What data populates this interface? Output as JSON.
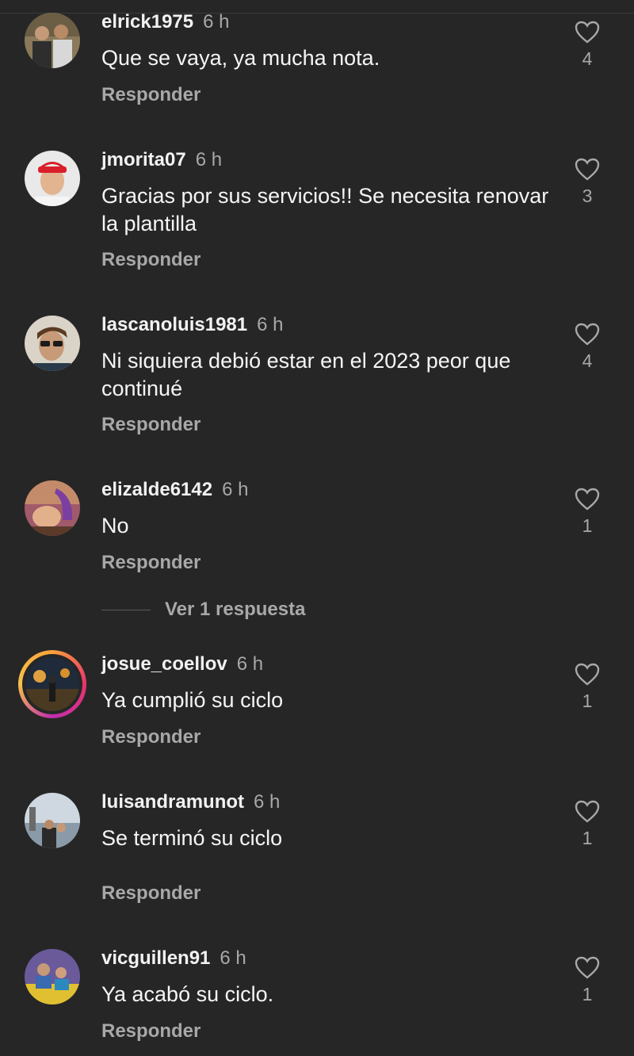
{
  "comments": [
    {
      "username": "elrick1975",
      "time": "6 h",
      "text": "Que se vaya, ya mucha nota.",
      "likes": "4",
      "reply": "Responder"
    },
    {
      "username": "jmorita07",
      "time": "6 h",
      "text": "Gracias por sus servicios!! Se necesita renovar la plantilla",
      "likes": "3",
      "reply": "Responder"
    },
    {
      "username": "lascanoluis1981",
      "time": "6 h",
      "text": "Ni siquiera debió estar en el 2023 peor que continué",
      "likes": "4",
      "reply": "Responder"
    },
    {
      "username": "elizalde6142",
      "time": "6 h",
      "text": "No",
      "likes": "1",
      "reply": "Responder",
      "view_replies": "Ver 1 respuesta"
    },
    {
      "username": "josue_coellov",
      "time": "6 h",
      "text": "Ya cumplió su ciclo",
      "likes": "1",
      "reply": "Responder"
    },
    {
      "username": "luisandramunot",
      "time": "6 h",
      "text": "Se terminó su ciclo",
      "likes": "1",
      "reply": "Responder"
    },
    {
      "username": "vicguillen91",
      "time": "6 h",
      "text": "Ya acabó su ciclo.",
      "likes": "1",
      "reply": "Responder"
    }
  ],
  "colors": {
    "background": "#262626",
    "primary_text": "#f5f5f5",
    "secondary_text": "#a8a8a8",
    "story_ring": "#e9336d"
  },
  "icons": {
    "like": "heart-outline-icon"
  }
}
